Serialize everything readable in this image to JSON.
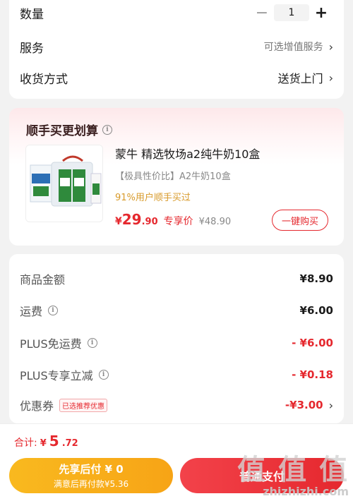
{
  "order": {
    "quantity_label": "数量",
    "quantity_value": "1",
    "minus_symbol": "−",
    "plus_symbol": "+",
    "service_label": "服务",
    "service_value": "可选增值服务",
    "delivery_label": "收货方式",
    "delivery_value": "送货上门",
    "chevron": "›"
  },
  "promo": {
    "title": "顺手买更划算",
    "product_name": "蒙牛 精选牧场a2纯牛奶10盒",
    "product_sub": "【极具性价比】A2牛奶10盒",
    "product_rate": "91%用户顺手买过",
    "price_currency": "¥",
    "price_int": "29",
    "price_dec": ".90",
    "price_tag": "专享价",
    "price_old": "¥48.90",
    "buy_button": "一键购买",
    "info_glyph": "i"
  },
  "summary": {
    "rows": [
      {
        "label": "商品金额",
        "value": "¥8.90"
      },
      {
        "label": "运费",
        "value": "¥6.00"
      },
      {
        "label": "PLUS免运费",
        "value": "- ¥6.00"
      },
      {
        "label": "PLUS专享立减",
        "value": "- ¥0.18"
      },
      {
        "label": "优惠券",
        "tag": "已选推荐优惠",
        "value": "-¥3.00"
      }
    ]
  },
  "footer": {
    "total_label": "合计:",
    "total_currency": "¥",
    "total_int": "5",
    "total_dec": ".72",
    "later_line1": "先享后付 ¥ 0",
    "later_line2": "满意后再付款¥5.36",
    "pay_button": "普通支付"
  },
  "watermark": {
    "big": "值 值 值",
    "small": "zhizhizhi.com"
  },
  "colors": {
    "accent_red": "#e5282e",
    "accent_orange": "#f7a416",
    "gold_text": "#d89a2a"
  }
}
